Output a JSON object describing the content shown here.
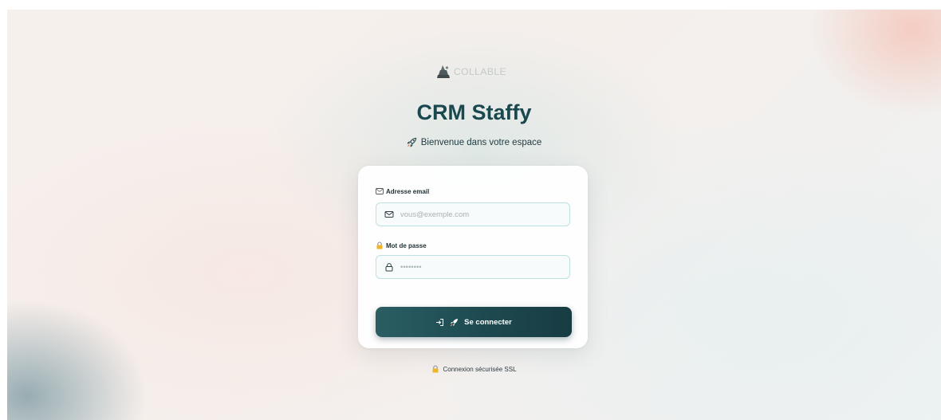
{
  "brand": {
    "logo_text": "COLLABLE",
    "logo_icon": "collable-logo-icon"
  },
  "header": {
    "title": "CRM Staffy",
    "subtitle": "Bienvenue dans votre espace",
    "subtitle_icon": "rocket-icon"
  },
  "form": {
    "email": {
      "label": "Adresse email",
      "label_icon": "email-card-icon",
      "placeholder": "vous@exemple.com",
      "value": "",
      "icon": "mail-icon"
    },
    "password": {
      "label": "Mot de passe",
      "label_icon": "lock-emoji-icon",
      "placeholder": "••••••••",
      "value": "",
      "icon": "lock-icon"
    },
    "submit": {
      "label": "Se connecter",
      "icons": [
        "login-icon",
        "rocket-icon"
      ]
    }
  },
  "footer": {
    "text": "Connexion sécurisée SSL",
    "icon": "lock-emoji-icon"
  },
  "colors": {
    "primary": "#1d4a50",
    "title": "#19484e",
    "input_border": "#bfe0e0",
    "logo": "#c3c9c9"
  }
}
